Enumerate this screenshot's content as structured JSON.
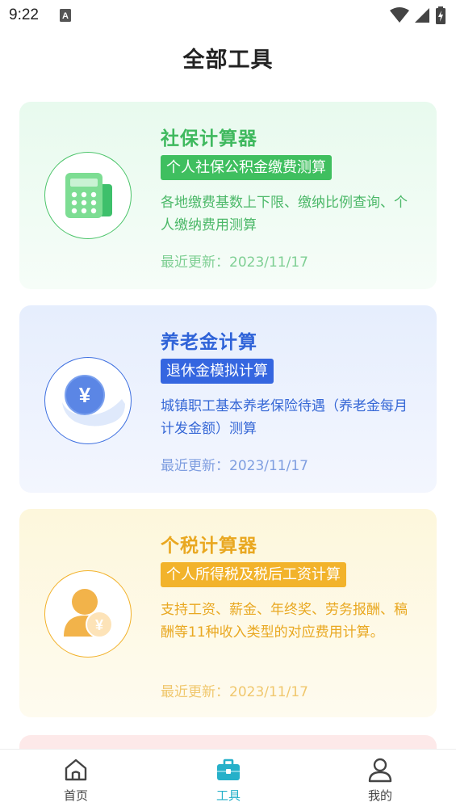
{
  "status_bar": {
    "time": "9:22"
  },
  "header": {
    "title": "全部工具"
  },
  "cards": [
    {
      "title": "社保计算器",
      "tag": "个人社保公积金缴费测算",
      "description": "各地缴费基数上下限、缴纳比例查询、个人缴纳费用测算",
      "updated": "最近更新：2023/11/17",
      "icon": "calculator-icon",
      "accent": "#3fbf5f"
    },
    {
      "title": "养老金计算",
      "tag": "退休金模拟计算",
      "description": "城镇职工基本养老保险待遇（养老金每月计发金额）测算",
      "updated": "最近更新：2023/11/17",
      "icon": "yuan-coin-hand-icon",
      "accent": "#3566e0"
    },
    {
      "title": "个税计算器",
      "tag": "个人所得税及税后工资计算",
      "description": "支持工资、薪金、年终奖、劳务报酬、稿酬等11种收入类型的对应费用计算。",
      "updated": "最近更新：2023/11/17",
      "icon": "person-yuan-icon",
      "accent": "#f2b32b"
    }
  ],
  "bottom_nav": {
    "items": [
      {
        "label": "首页",
        "icon": "home-icon",
        "active": false
      },
      {
        "label": "工具",
        "icon": "toolbox-icon",
        "active": true,
        "color": "#26b0c9"
      },
      {
        "label": "我的",
        "icon": "user-icon",
        "active": false
      }
    ]
  }
}
